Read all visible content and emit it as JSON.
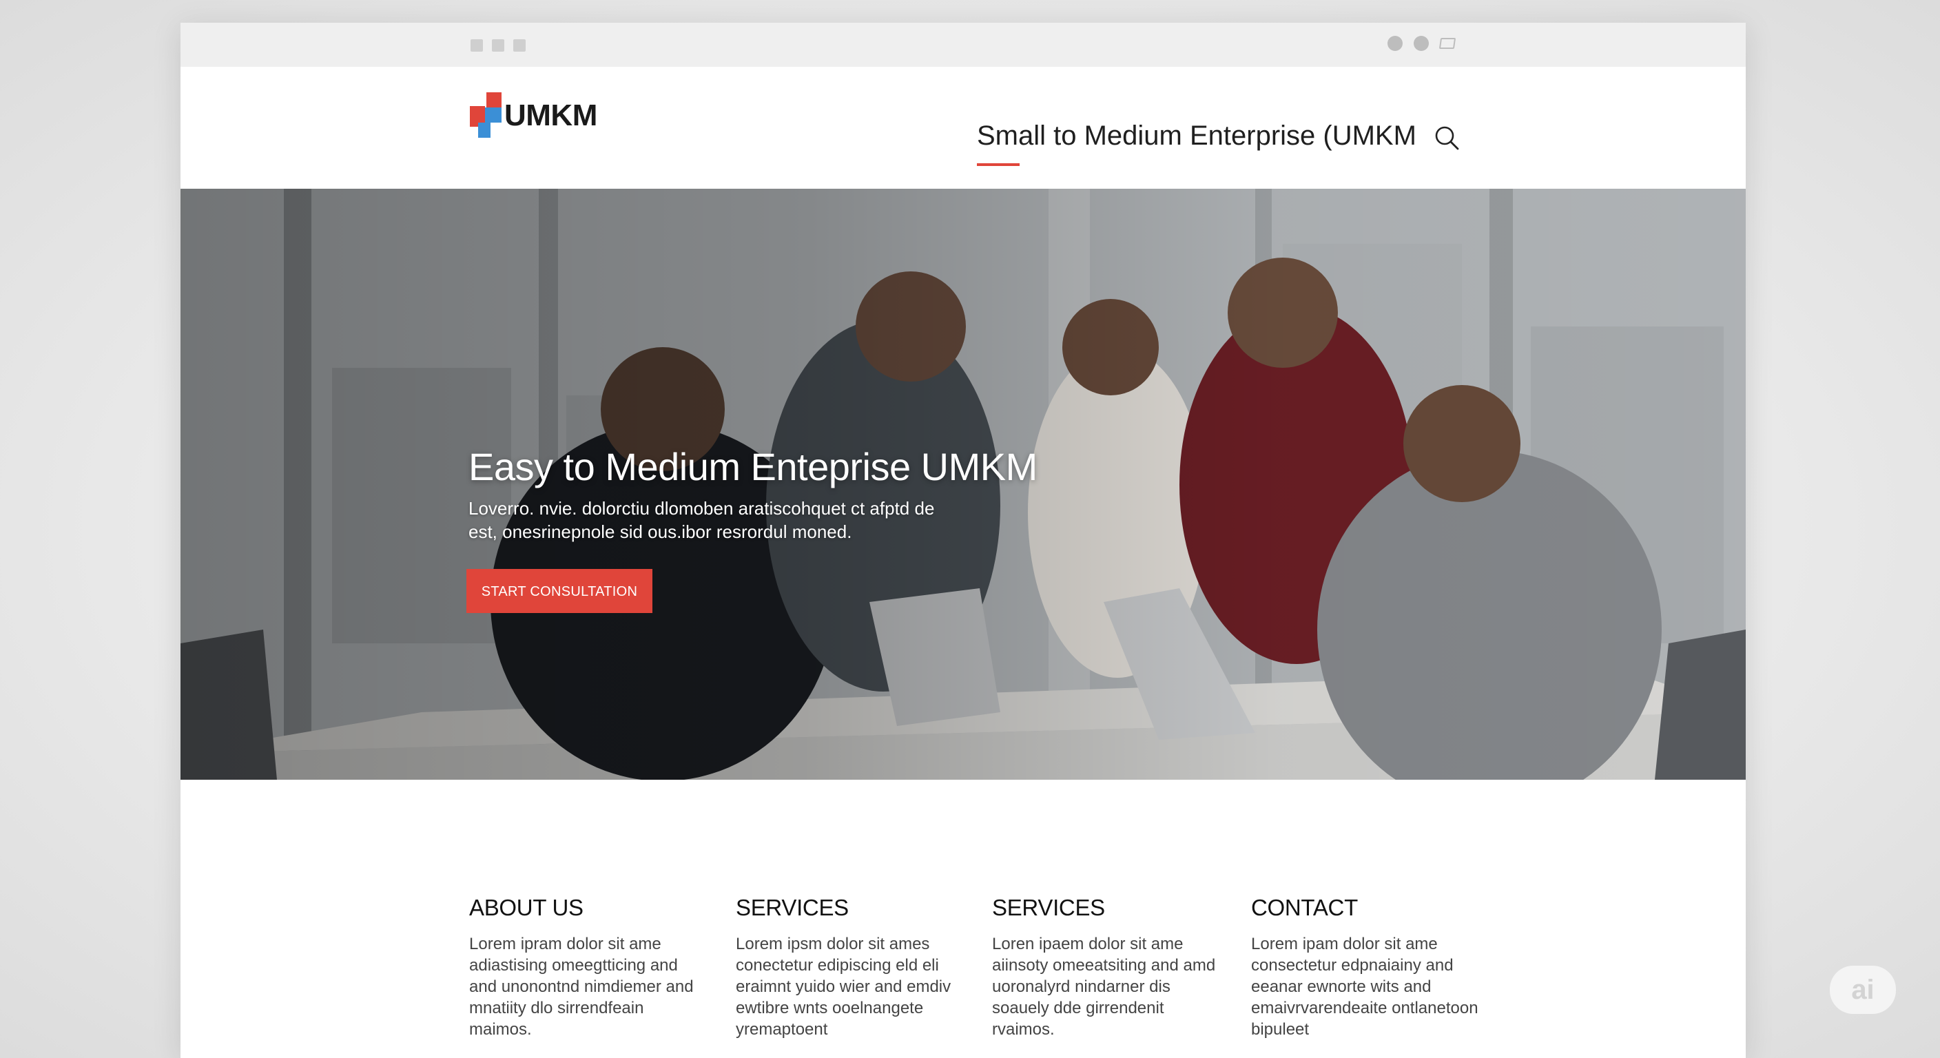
{
  "window": {
    "controls": [
      "minimize-icon",
      "maximize-icon",
      "share-icon"
    ]
  },
  "header": {
    "logo_text": "UMKM",
    "nav_label": "Small to Medium Enterprise (UMKM",
    "search_icon": "search-icon",
    "accent_color": "#e0453a",
    "logo_blue": "#3b8fd6"
  },
  "hero": {
    "title": "Easy to Medium Enteprise UMKM",
    "subtitle": "Loverro. nvie. dolorctiu dlomoben aratiscohquet ct afptd de est, onesrinepnole sid ous.ibor resrordul moned.",
    "cta_label": "START CONSULTATION"
  },
  "columns": [
    {
      "heading": "ABOUT US",
      "body": "Lorem ipram dolor sit ame adiastising omeegtticing and and unonontnd nimdiemer and mnatiity dlo sirrendfeain maimos."
    },
    {
      "heading": "SERVICES",
      "body": "Lorem ipsm dolor sit ames conectetur edipiscing eld eli eraimnt yuido wier and emdiv ewtibre wnts ooelnangete yremaptoent"
    },
    {
      "heading": "SERVICES",
      "body": "Loren ipaem dolor sit ame aiinsoty omeeatsiting and amd uoronalyrd nindarner dis soauely dde girrendenit rvaimos."
    },
    {
      "heading": "CONTACT",
      "body": "Lorem ipam dolor sit ame consectetur edpnaiainy and eeanar ewnorte wits and emaivrvarendeaite ontlanetoon bipuleet"
    }
  ],
  "badge": {
    "label": "ai"
  }
}
